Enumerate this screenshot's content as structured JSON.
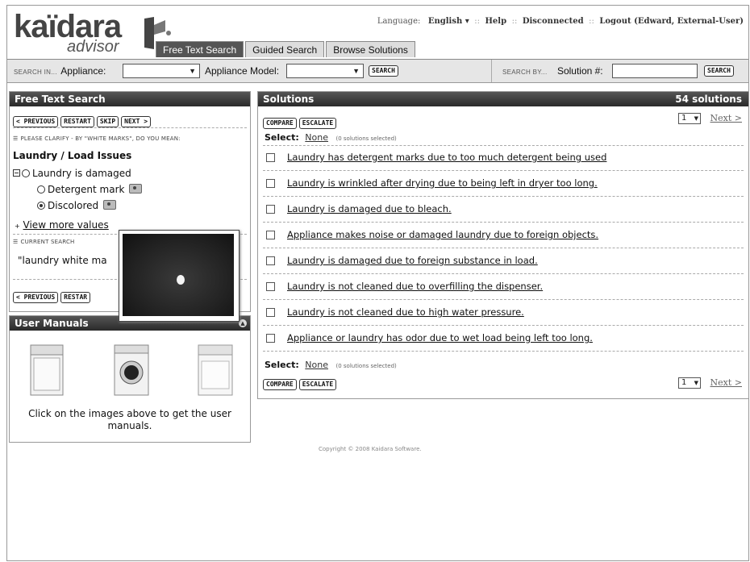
{
  "logo": {
    "main": "kaïdara",
    "sub": "advisor"
  },
  "top": {
    "language_label": "Language:",
    "language_value": "English",
    "help": "Help",
    "status": "Disconnected",
    "logout": "Logout (Edward, External-User)"
  },
  "tabs": [
    {
      "label": "Free Text Search",
      "active": true
    },
    {
      "label": "Guided Search",
      "active": false
    },
    {
      "label": "Browse Solutions",
      "active": false
    }
  ],
  "searchbar": {
    "search_in": "SEARCH IN...",
    "appliance_label": "Appliance:",
    "appliance_value": "",
    "model_label": "Appliance Model:",
    "model_value": "",
    "search_button": "SEARCH",
    "search_by": "SEARCH BY...",
    "solution_label": "Solution #:",
    "solution_value": "",
    "search_button2": "SEARCH"
  },
  "free_text": {
    "title": "Free Text Search",
    "buttons": [
      "< PREVIOUS",
      "RESTART",
      "SKIP",
      "NEXT >"
    ],
    "clarify": "PLEASE CLARIFY - BY \"WHITE MARKS\", DO YOU MEAN:",
    "question": "Laundry / Load Issues",
    "options": [
      {
        "label": "Laundry is damaged",
        "selected": false
      },
      {
        "label": "Detergent mark",
        "selected": false
      },
      {
        "label": "Discolored",
        "selected": true
      }
    ],
    "more": "View more values",
    "current_search_label": "CURRENT SEARCH",
    "current_search": "\"laundry white ma",
    "bottom_buttons": [
      "< PREVIOUS",
      "RESTAR"
    ]
  },
  "manuals": {
    "title": "User Manuals",
    "text": "Click on the images above to get the user manuals."
  },
  "solutions": {
    "title": "Solutions",
    "count": "54 solutions",
    "compare": "COMPARE",
    "escalate": "ESCALATE",
    "select_label": "Select:",
    "select_none": "None",
    "selected_note": "(0 solutions selected)",
    "page": "1",
    "next": "Next >",
    "items": [
      "Laundry has detergent marks due to too much detergent being used",
      "Laundry is wrinkled after drying due to being left in dryer too long.",
      "Laundry is damaged due to bleach.",
      "Appliance makes noise or damaged laundry due to foreign objects.",
      "Laundry is damaged due to foreign substance in load.",
      "Laundry is not cleaned due to overfilling the dispenser.",
      "Laundry is not cleaned due to high water pressure.",
      "Appliance or laundry has odor due to wet load being left too long."
    ]
  },
  "copyright": "Copyright © 2008 Kaidara Software."
}
